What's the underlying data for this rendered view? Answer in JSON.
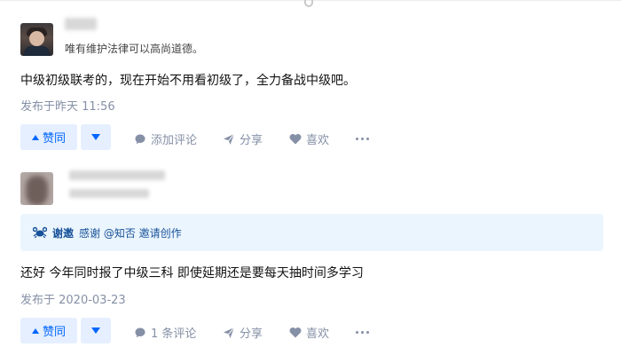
{
  "post1": {
    "headline": "唯有维护法律可以高尚道德。",
    "content": "中级初级联考的，现在开始不用看初级了，全力备战中级吧。",
    "time": "发布于昨天 11:56",
    "vote_label": "赞同",
    "comment_label": "添加评论",
    "share_label": "分享",
    "like_label": "喜欢"
  },
  "post2": {
    "thanks_strong": "谢邀",
    "thanks_text": "感谢 @知否 邀请创作",
    "content": "还好 今年同时报了中级三科 即使延期还是要每天抽时间多学习",
    "time": "发布于 2020-03-23",
    "vote_label": "赞同",
    "comment_label": "1 条评论",
    "share_label": "分享",
    "like_label": "喜欢"
  },
  "colors": {
    "accent": "#0066ff",
    "vote_bg": "#e5efff",
    "meta": "#8590a6",
    "thanks_bg": "#ebf5fd"
  },
  "icons": [
    "comment-icon",
    "share-icon",
    "heart-icon",
    "more-icon",
    "crab-icon"
  ]
}
